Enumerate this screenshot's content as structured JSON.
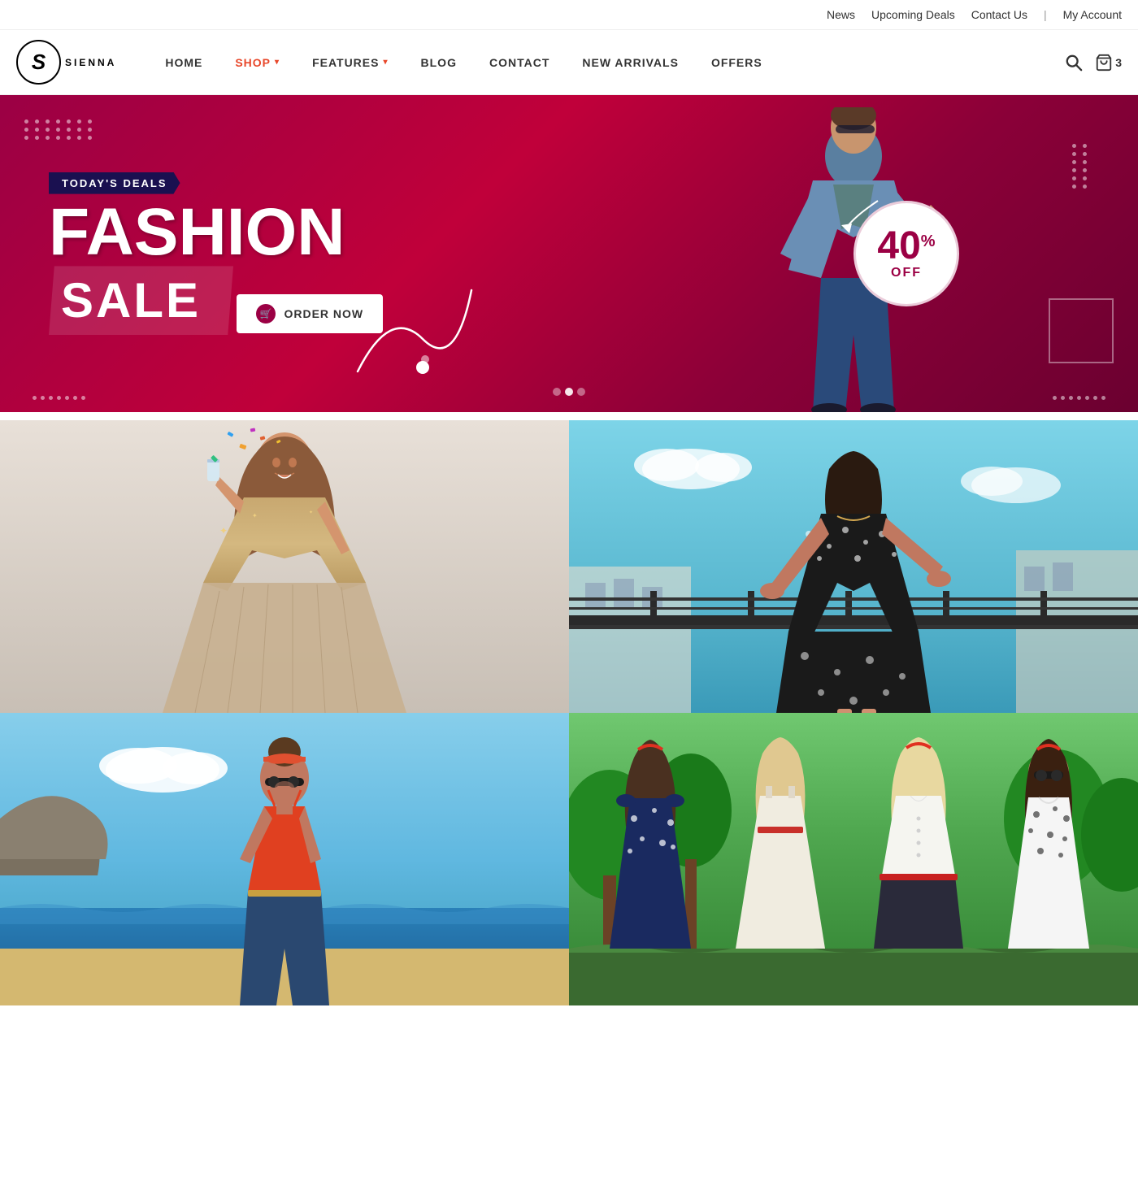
{
  "topbar": {
    "links": [
      {
        "id": "news",
        "label": "News"
      },
      {
        "id": "upcoming-deals",
        "label": "Upcoming Deals"
      },
      {
        "id": "contact-us",
        "label": "Contact Us"
      },
      {
        "id": "my-account",
        "label": "My Account"
      }
    ]
  },
  "logo": {
    "letter": "S",
    "brand": "SIENNA"
  },
  "nav": {
    "items": [
      {
        "id": "home",
        "label": "HOME",
        "active": false,
        "hasDropdown": false
      },
      {
        "id": "shop",
        "label": "SHOP",
        "active": true,
        "hasDropdown": true
      },
      {
        "id": "features",
        "label": "FEATURES",
        "active": false,
        "hasDropdown": true
      },
      {
        "id": "blog",
        "label": "BLOG",
        "active": false,
        "hasDropdown": false
      },
      {
        "id": "contact",
        "label": "CONTACT",
        "active": false,
        "hasDropdown": false
      },
      {
        "id": "new-arrivals",
        "label": "NEW ARRIVALS",
        "active": false,
        "hasDropdown": false
      },
      {
        "id": "offers",
        "label": "OFFERS",
        "active": false,
        "hasDropdown": false
      }
    ],
    "cart_count": "3"
  },
  "hero": {
    "badge": "TODAY'S DEALS",
    "title": "FASHION",
    "subtitle": "SALE",
    "discount_number": "40",
    "discount_percent": "%",
    "discount_off": "OFF",
    "cta_label": "ORDER NOW",
    "slide_dots": [
      {
        "active": false
      },
      {
        "active": true
      },
      {
        "active": false
      }
    ]
  },
  "products": [
    {
      "id": "product-1",
      "alt": "Woman in sparkly dress with confetti",
      "bg_from": "#d4c5b0",
      "bg_to": "#e8ddd0"
    },
    {
      "id": "product-2",
      "alt": "Woman in black dress on rooftop",
      "bg_from": "#7dd4c8",
      "bg_to": "#2a7a8c"
    },
    {
      "id": "product-3",
      "alt": "Woman in red top at beach",
      "bg_from": "#87ceeb",
      "bg_to": "#a0d8ef"
    },
    {
      "id": "product-4",
      "alt": "Group of women in polka dot dresses",
      "bg_from": "#5fb85f",
      "bg_to": "#2d7030"
    }
  ],
  "colors": {
    "primary": "#9b0044",
    "accent": "#e8472a",
    "nav_active": "#e8472a"
  }
}
